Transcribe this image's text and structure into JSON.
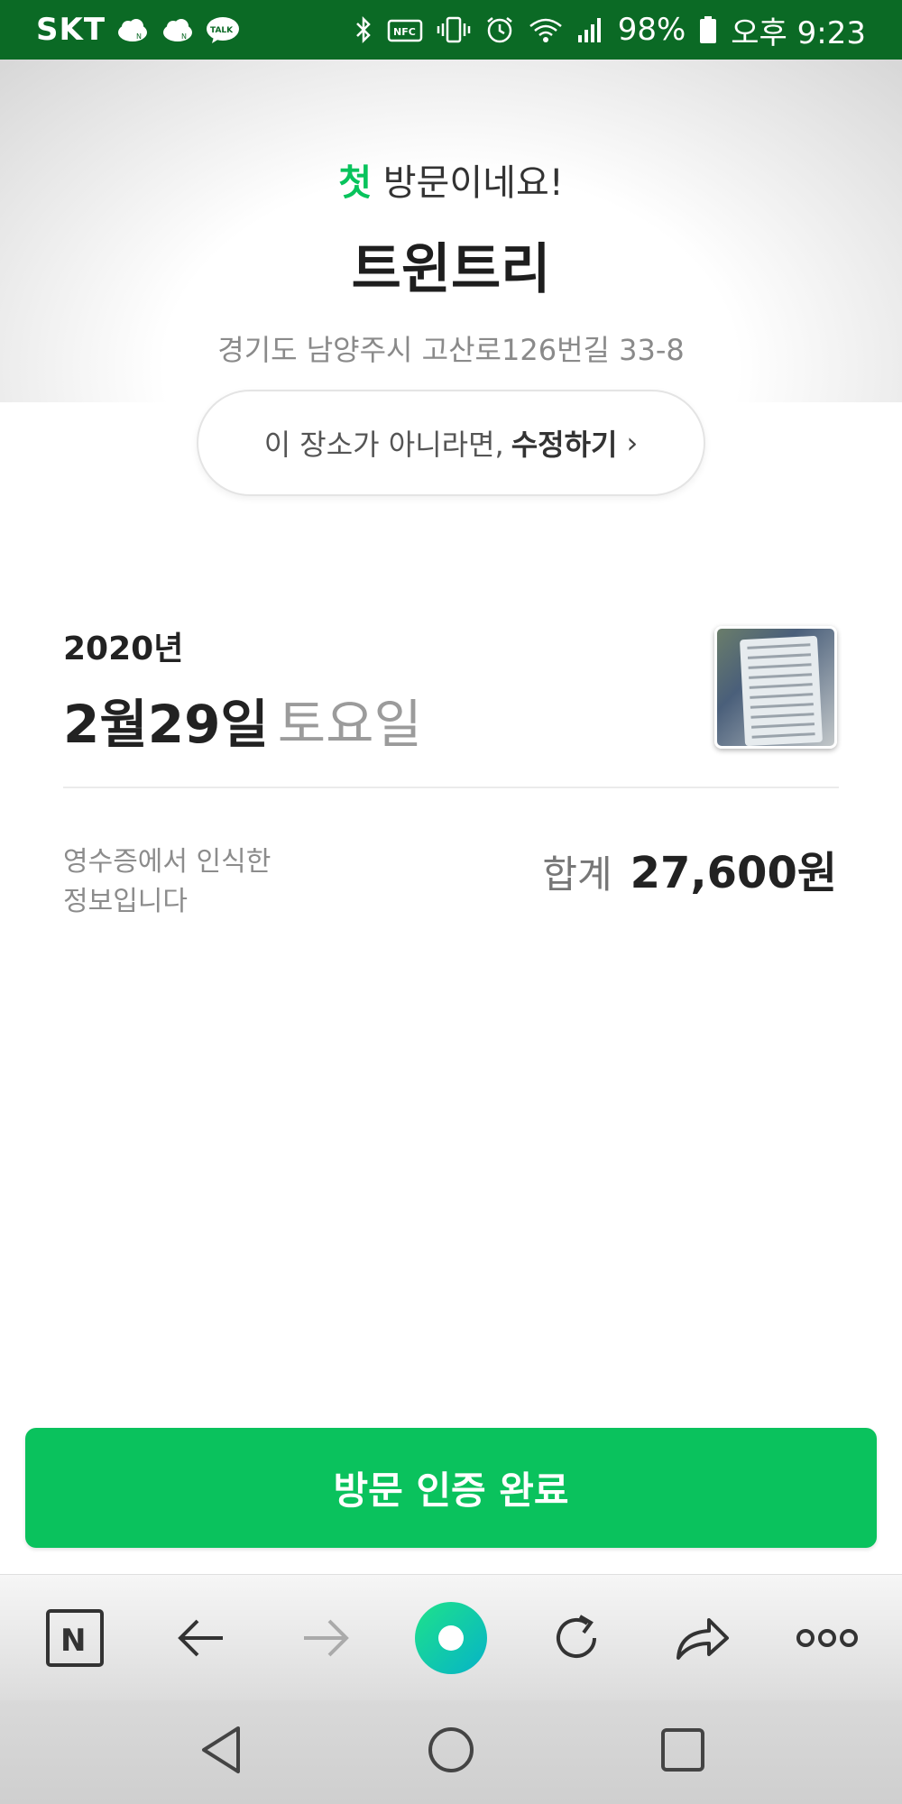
{
  "status_bar": {
    "carrier": "SKT",
    "left_icons": [
      "naver-cloud-icon",
      "naver-cloud-icon",
      "kakaotalk-icon"
    ],
    "left_icon_labels": [
      "N",
      "N",
      "TALK"
    ],
    "right_icons": [
      "bluetooth-icon",
      "nfc-icon",
      "vibrate-icon",
      "alarm-icon",
      "wifi-icon",
      "signal-icon",
      "battery-icon"
    ],
    "nfc_label": "NFC",
    "battery": "98%",
    "time": "오후 9:23"
  },
  "header": {
    "first_visit_accent": "첫",
    "first_visit_rest": " 방문이네요!",
    "place_name": "트윈트리",
    "address": "경기도 남양주시 고산로126번길 33-8"
  },
  "edit_prompt": {
    "text": "이 장소가 아니라면,",
    "action": "수정하기",
    "chevron": "›"
  },
  "visit_date": {
    "year": "2020년",
    "month_day": "2월29일",
    "weekday": "토요일"
  },
  "receipt": {
    "note": [
      "영수증에서 인식한",
      "정보입니다"
    ],
    "total_label": "합계",
    "total_value": "27,600원"
  },
  "confirm_button": {
    "label": "방문 인증 완료"
  },
  "browser_toolbar": {
    "items": [
      "naver-home-icon",
      "back-arrow-icon",
      "forward-arrow-icon",
      "green-dot-icon",
      "refresh-icon",
      "share-icon",
      "more-icon"
    ],
    "home_letter": "N"
  },
  "nav_bar": {
    "items": [
      "nav-back-icon",
      "nav-home-icon",
      "nav-recents-icon"
    ]
  },
  "colors": {
    "status_bar": "#0b6a25",
    "accent_green": "#08c35c",
    "button_green": "#0ac25d"
  }
}
